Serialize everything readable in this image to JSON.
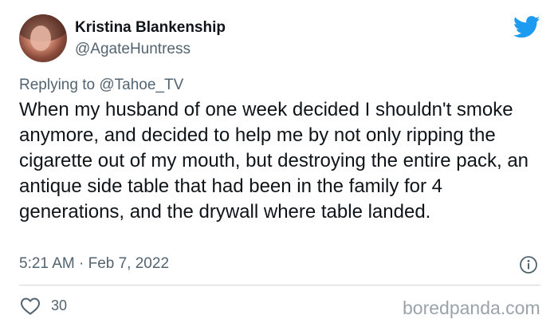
{
  "author": {
    "display_name": "Kristina Blankenship",
    "handle": "@AgateHuntress"
  },
  "reply": {
    "prefix": "Replying to",
    "target": "@Tahoe_TV"
  },
  "tweet": {
    "text": "When my husband of one week decided I shouldn't smoke anymore, and decided to help me by not only ripping the cigarette out of my mouth, but destroying the entire pack, an antique side table that had been in the family for 4 generations, and the drywall where table landed.",
    "timestamp": "5:21 AM · Feb 7, 2022",
    "like_count": "30"
  },
  "icons": {
    "brand": "twitter-bird-icon",
    "info": "info-icon",
    "like": "heart-icon"
  },
  "colors": {
    "twitter_blue": "#1d9bf0",
    "secondary_text": "#536471",
    "primary_text": "#0f1419",
    "divider": "#cfd9de",
    "watermark": "#9aa3a8"
  },
  "watermark": "boredpanda.com"
}
